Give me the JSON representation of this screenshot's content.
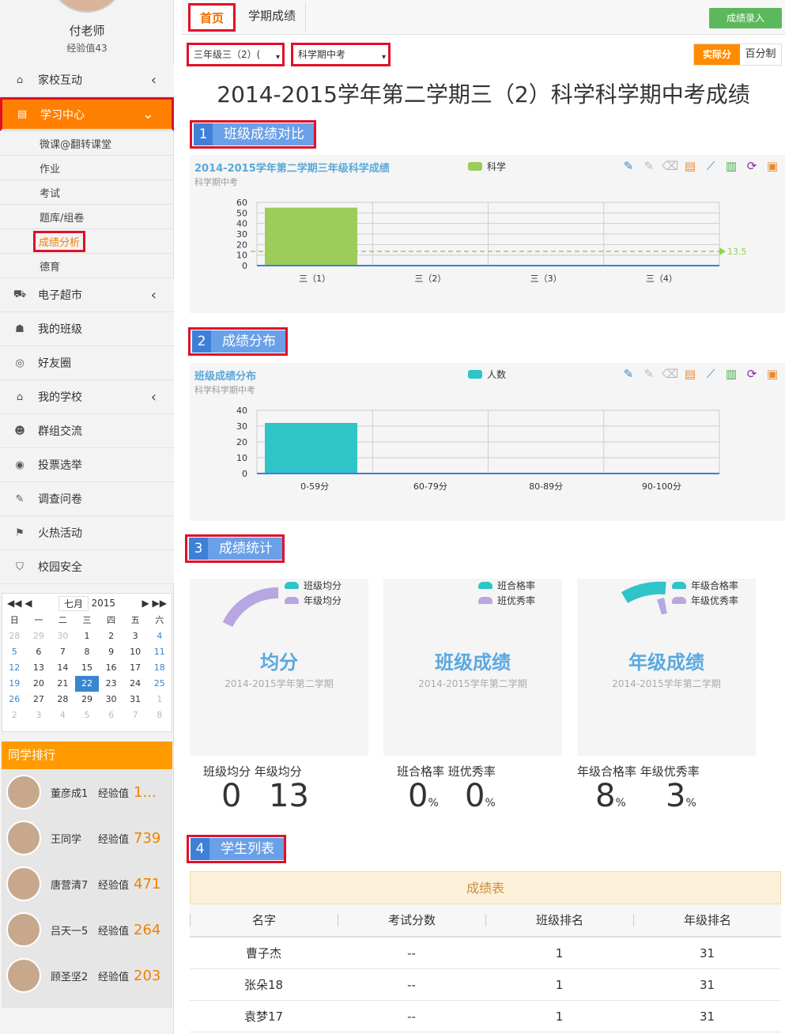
{
  "sidebar": {
    "teacher_name": "付老师",
    "experience": "经验值43",
    "menu": [
      {
        "label": "家校互动",
        "icon": "home-icon",
        "arrow": "‹"
      },
      {
        "label": "学习中心",
        "icon": "book-icon",
        "arrow": "⌄",
        "active": true
      },
      {
        "label": "电子超市",
        "icon": "cart-icon",
        "arrow": "‹"
      },
      {
        "label": "我的班级",
        "icon": "group-icon"
      },
      {
        "label": "好友圈",
        "icon": "circle-icon"
      },
      {
        "label": "我的学校",
        "icon": "bank-icon",
        "arrow": "‹"
      },
      {
        "label": "群组交流",
        "icon": "users-icon"
      },
      {
        "label": "投票选举",
        "icon": "vote-icon"
      },
      {
        "label": "调查问卷",
        "icon": "edit-icon"
      },
      {
        "label": "火热活动",
        "icon": "flag-icon"
      },
      {
        "label": "校园安全",
        "icon": "shield-icon"
      }
    ],
    "submenu": [
      "微课@翻转课堂",
      "作业",
      "考试",
      "题库/组卷",
      "成绩分析",
      "德育"
    ]
  },
  "calendar": {
    "month": "七月",
    "year": "2015",
    "weekdays": [
      "日",
      "一",
      "二",
      "三",
      "四",
      "五",
      "六"
    ],
    "days": [
      [
        "28",
        "29",
        "30",
        "1",
        "2",
        "3",
        "4"
      ],
      [
        "5",
        "6",
        "7",
        "8",
        "9",
        "10",
        "11"
      ],
      [
        "12",
        "13",
        "14",
        "15",
        "16",
        "17",
        "18"
      ],
      [
        "19",
        "20",
        "21",
        "22",
        "23",
        "24",
        "25"
      ],
      [
        "26",
        "27",
        "28",
        "29",
        "30",
        "31",
        "1"
      ],
      [
        "2",
        "3",
        "4",
        "5",
        "6",
        "7",
        "8"
      ]
    ],
    "today": "22"
  },
  "ranking": {
    "title": "同学排行",
    "label": "经验值",
    "items": [
      {
        "name": "董彦成1",
        "value": "1..."
      },
      {
        "name": "王同学",
        "value": "739"
      },
      {
        "name": "唐营清7",
        "value": "471"
      },
      {
        "name": "吕天一5",
        "value": "264"
      },
      {
        "name": "顾圣坚2",
        "value": "203"
      }
    ]
  },
  "tabs": {
    "home": "首页",
    "term": "学期成绩"
  },
  "enter_button": "成绩录入",
  "filters": {
    "class": "三年级三（2）(",
    "exam": "科学期中考"
  },
  "toggle": {
    "actual": "实际分",
    "percent": "百分制"
  },
  "page_title": "2014-2015学年第二学期三（2）科学科学期中考成绩",
  "sections": [
    {
      "num": "1",
      "label": "班级成绩对比"
    },
    {
      "num": "2",
      "label": "成绩分布"
    },
    {
      "num": "3",
      "label": "成绩统计"
    },
    {
      "num": "4",
      "label": "学生列表"
    }
  ],
  "chart_data": [
    {
      "type": "bar",
      "title": "2014-2015学年第二学期三年级科学成绩",
      "subtitle": "科学期中考",
      "categories": [
        "三（1）",
        "三（2）",
        "三（3）",
        "三（4）"
      ],
      "series": [
        {
          "name": "科学",
          "values": [
            55,
            0,
            0,
            0
          ],
          "color": "#9ccc5a"
        }
      ],
      "avg_line": {
        "value": 13.5,
        "label": "13.5"
      },
      "ylim": [
        0,
        60
      ],
      "yticks": [
        "0",
        "10",
        "20",
        "30",
        "40",
        "50",
        "60"
      ],
      "legend": "top-center"
    },
    {
      "type": "bar",
      "title": "班级成绩分布",
      "subtitle": "科学科学期中考",
      "categories": [
        "0-59分",
        "60-79分",
        "80-89分",
        "90-100分"
      ],
      "series": [
        {
          "name": "人数",
          "values": [
            32,
            0,
            0,
            0
          ],
          "color": "#2ec4c8"
        }
      ],
      "ylim": [
        0,
        40
      ],
      "yticks": [
        "0",
        "10",
        "20",
        "30",
        "40"
      ],
      "legend": "top-center"
    }
  ],
  "stats": [
    {
      "title": "均分",
      "sub": "2014-2015学年第二学期",
      "legend": [
        "班级均分",
        "年级均分"
      ],
      "labels": "班级均分 年级均分",
      "v1": "0",
      "v2": "13",
      "unit": ""
    },
    {
      "title": "班级成绩",
      "sub": "2014-2015学年第二学期",
      "legend": [
        "班合格率",
        "班优秀率"
      ],
      "labels": "班合格率 班优秀率",
      "v1": "0",
      "v2": "0",
      "unit": "%"
    },
    {
      "title": "年级成绩",
      "sub": "2014-2015学年第二学期",
      "legend": [
        "年级合格率",
        "年级优秀率"
      ],
      "labels": "年级合格率 年级优秀率",
      "v1": "8",
      "v2": "3",
      "unit": "%"
    }
  ],
  "table": {
    "caption": "成绩表",
    "headers": [
      "名字",
      "考试分数",
      "班级排名",
      "年级排名"
    ],
    "rows": [
      [
        "曹子杰",
        "--",
        "1",
        "31"
      ],
      [
        "张朵18",
        "--",
        "1",
        "31"
      ],
      [
        "袁梦17",
        "--",
        "1",
        "31"
      ]
    ]
  },
  "colors": {
    "accent": "#ff7f00",
    "blue": "#3e80d8",
    "green": "#5cb85c",
    "teal": "#2ec4c8",
    "purple": "#b8a6e0"
  }
}
